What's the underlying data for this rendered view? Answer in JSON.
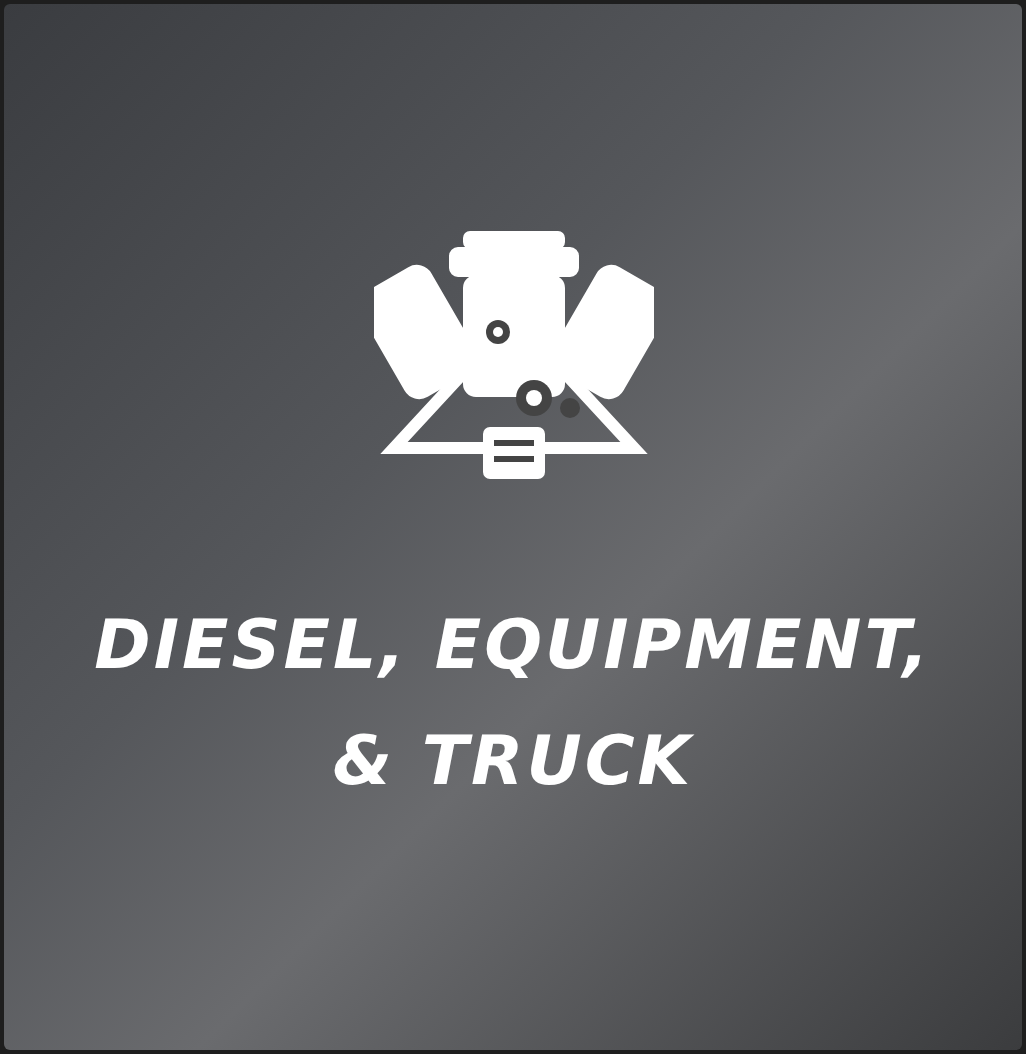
{
  "tile": {
    "title": "DIESEL, EQUIPMENT, & TRUCK"
  }
}
